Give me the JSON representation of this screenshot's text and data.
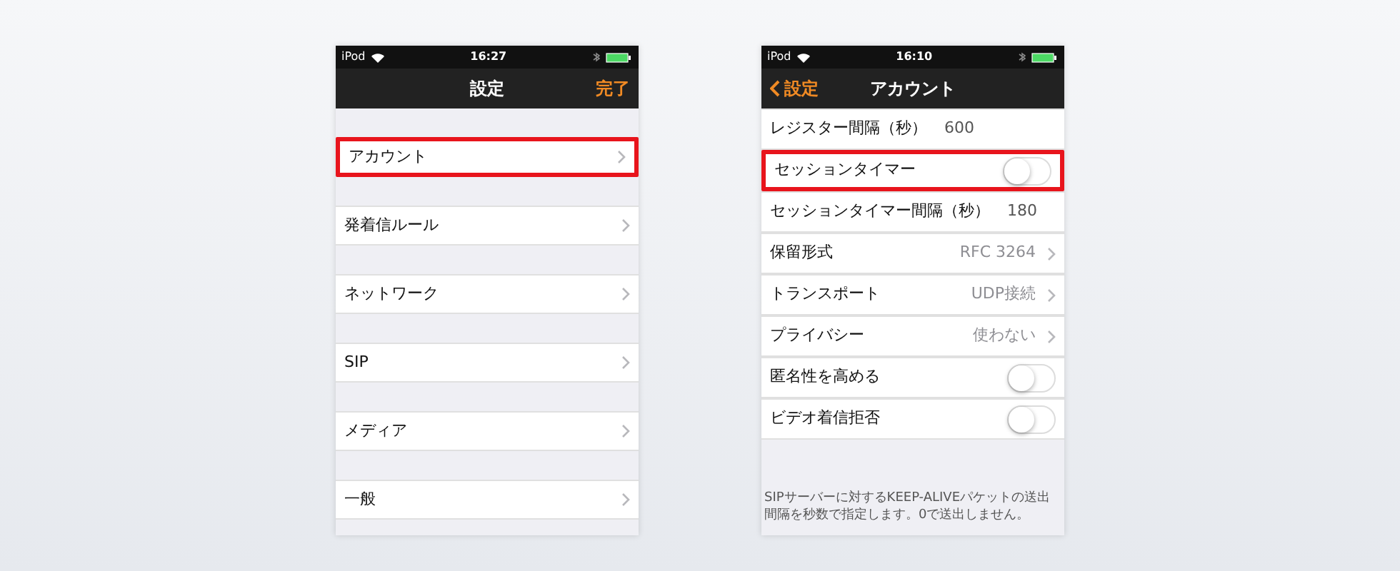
{
  "screens": [
    {
      "status_bar": {
        "carrier": "iPod",
        "time": "16:27"
      },
      "nav": {
        "title": "設定",
        "action": "完了"
      },
      "kind": "grouped",
      "items": [
        {
          "kind": "nav",
          "label": "アカウント",
          "highlighted": true
        },
        {
          "kind": "nav",
          "label": "発着信ルール",
          "highlighted": false
        },
        {
          "kind": "nav",
          "label": "ネットワーク",
          "highlighted": false
        },
        {
          "kind": "nav",
          "label": "SIP",
          "highlighted": false
        },
        {
          "kind": "nav",
          "label": "メディア",
          "highlighted": false
        },
        {
          "kind": "nav",
          "label": "一般",
          "highlighted": false
        }
      ]
    },
    {
      "status_bar": {
        "carrier": "iPod",
        "time": "16:10"
      },
      "nav": {
        "back": "設定",
        "title": "アカウント"
      },
      "kind": "plain",
      "items": [
        {
          "kind": "field",
          "label": "レジスター間隔（秒）",
          "value": "600",
          "highlighted": false
        },
        {
          "kind": "toggle",
          "label": "セッションタイマー",
          "on": false,
          "highlighted": true
        },
        {
          "kind": "field",
          "label": "セッションタイマー間隔（秒）",
          "value": "180",
          "highlighted": false
        },
        {
          "kind": "nav",
          "label": "保留形式",
          "value": "RFC 3264",
          "highlighted": false
        },
        {
          "kind": "nav",
          "label": "トランスポート",
          "value": "UDP接続",
          "highlighted": false
        },
        {
          "kind": "nav",
          "label": "プライバシー",
          "value": "使わない",
          "highlighted": false
        },
        {
          "kind": "toggle",
          "label": "匿名性を高める",
          "on": false,
          "highlighted": false
        },
        {
          "kind": "toggle",
          "label": "ビデオ着信拒否",
          "on": false,
          "highlighted": false
        }
      ],
      "footer": "SIPサーバーに対するKEEP-ALIVEパケットの送出間隔を秒数で指定します。0で送出しません。"
    }
  ]
}
